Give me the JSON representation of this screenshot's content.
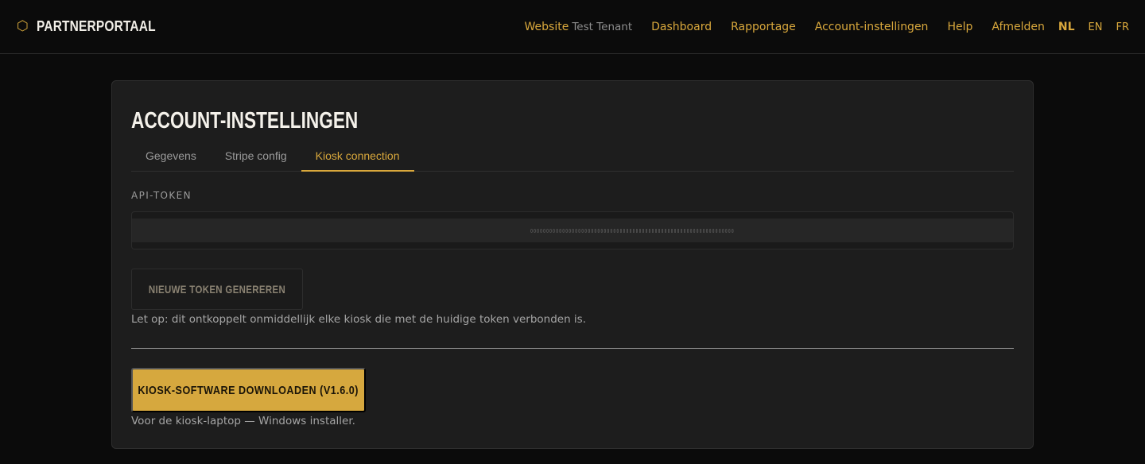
{
  "brand": {
    "icon": "hexagon-icon",
    "name": "PARTNERPORTAAL",
    "accent": "#d9a83c"
  },
  "nav": {
    "website_label": "Website",
    "tenant_name": "Test Tenant",
    "items": [
      "Dashboard",
      "Rapportage",
      "Account-instellingen",
      "Help",
      "Afmelden"
    ],
    "languages": [
      "NL",
      "EN",
      "FR"
    ],
    "active_language": "NL"
  },
  "page": {
    "title": "ACCOUNT-INSTELLINGEN",
    "tabs": [
      {
        "label": "Gegevens",
        "active": false
      },
      {
        "label": "Stripe config",
        "active": false
      },
      {
        "label": "Kiosk connection",
        "active": true
      }
    ]
  },
  "kiosk": {
    "api_token_label": "API-TOKEN",
    "token_value": "▯▯▯▯▯▯▯▯▯▯▯▯▯▯▯▯▯▯▯▯▯▯▯▯▯▯▯▯▯▯▯▯▯▯▯▯▯▯▯▯▯▯▯▯▯▯▯▯▯▯▯▯▯▯▯▯▯▯▯▯▯▯▯▯",
    "regenerate_button": "NIEUWE TOKEN GENEREREN",
    "warning": "Let op: dit ontkoppelt onmiddellijk elke kiosk die met de huidige token verbonden is.",
    "download_button": "KIOSK-SOFTWARE DOWNLOADEN (V1.6.0)",
    "download_hint": "Voor de kiosk-laptop — Windows installer."
  }
}
